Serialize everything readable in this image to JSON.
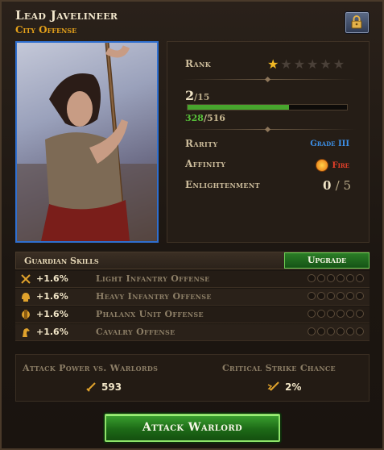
{
  "header": {
    "title": "Lead Javelineer",
    "subtitle": "City Offense"
  },
  "icons": {
    "lock": "lock-icon",
    "star": "star-icon",
    "fire": "fire-icon",
    "sword": "sword-icon",
    "critical": "critical-strike-icon"
  },
  "info": {
    "rank_label": "Rank",
    "rank_stars_filled": 1,
    "rank_stars_total": 6,
    "level": "2",
    "level_max": "/15",
    "xp_current": "328",
    "xp_max": "/516",
    "xp_fraction": 0.636,
    "rarity_label": "Rarity",
    "rarity_value": "Grade III",
    "affinity_label": "Affinity",
    "affinity_value": "Fire",
    "enlightenment_label": "Enlightenment",
    "enlightenment_value": "0",
    "enlightenment_max": "/ 5"
  },
  "skills": {
    "header": "Guardian Skills",
    "upgrade_label": "Upgrade",
    "items": [
      {
        "value": "+1.6%",
        "name": "Light Infantry Offense",
        "icon": "crossed-swords-icon"
      },
      {
        "value": "+1.6%",
        "name": "Heavy Infantry Offense",
        "icon": "helmet-icon"
      },
      {
        "value": "+1.6%",
        "name": "Phalanx Unit Offense",
        "icon": "phalanx-helmet-icon"
      },
      {
        "value": "+1.6%",
        "name": "Cavalry Offense",
        "icon": "horse-icon"
      }
    ]
  },
  "stats": {
    "attack_label": "Attack Power vs. Warlords",
    "attack_value": "593",
    "crit_label": "Critical Strike Chance",
    "crit_value": "2%"
  },
  "actions": {
    "attack_label": "Attack Warlord"
  },
  "colors": {
    "accent_gold": "#e6a21a",
    "xp_green": "#47a52d",
    "grade_blue": "#3c8fe6",
    "fire_red": "#e8402a",
    "portrait_border": "#2f6fcf"
  }
}
